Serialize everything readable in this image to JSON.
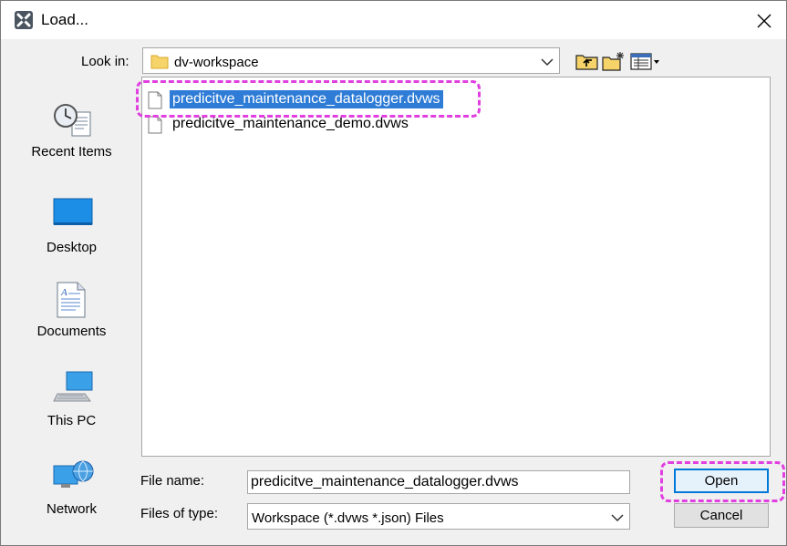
{
  "window": {
    "title": "Load..."
  },
  "look_in": {
    "label": "Look in:",
    "value": "dv-workspace"
  },
  "toolbar": {
    "icons": [
      "up-one-level-icon",
      "create-new-folder-icon",
      "details-view-icon"
    ]
  },
  "places": [
    {
      "label": "Recent Items",
      "icon": "recent-items-icon"
    },
    {
      "label": "Desktop",
      "icon": "desktop-icon"
    },
    {
      "label": "Documents",
      "icon": "documents-icon"
    },
    {
      "label": "This PC",
      "icon": "this-pc-icon"
    },
    {
      "label": "Network",
      "icon": "network-icon"
    }
  ],
  "files": [
    {
      "name": "predicitve_maintenance_datalogger.dvws",
      "selected": true
    },
    {
      "name": "predicitve_maintenance_demo.dvws",
      "selected": false
    }
  ],
  "file_name": {
    "label": "File name:",
    "value": "predicitve_maintenance_datalogger.dvws"
  },
  "files_of_type": {
    "label": "Files of type:",
    "value": "Workspace (*.dvws *.json) Files"
  },
  "buttons": {
    "open": "Open",
    "cancel": "Cancel"
  },
  "colors": {
    "selection": "#2e7cd6",
    "highlight": "#e040e0",
    "primary_border": "#0078d7"
  }
}
